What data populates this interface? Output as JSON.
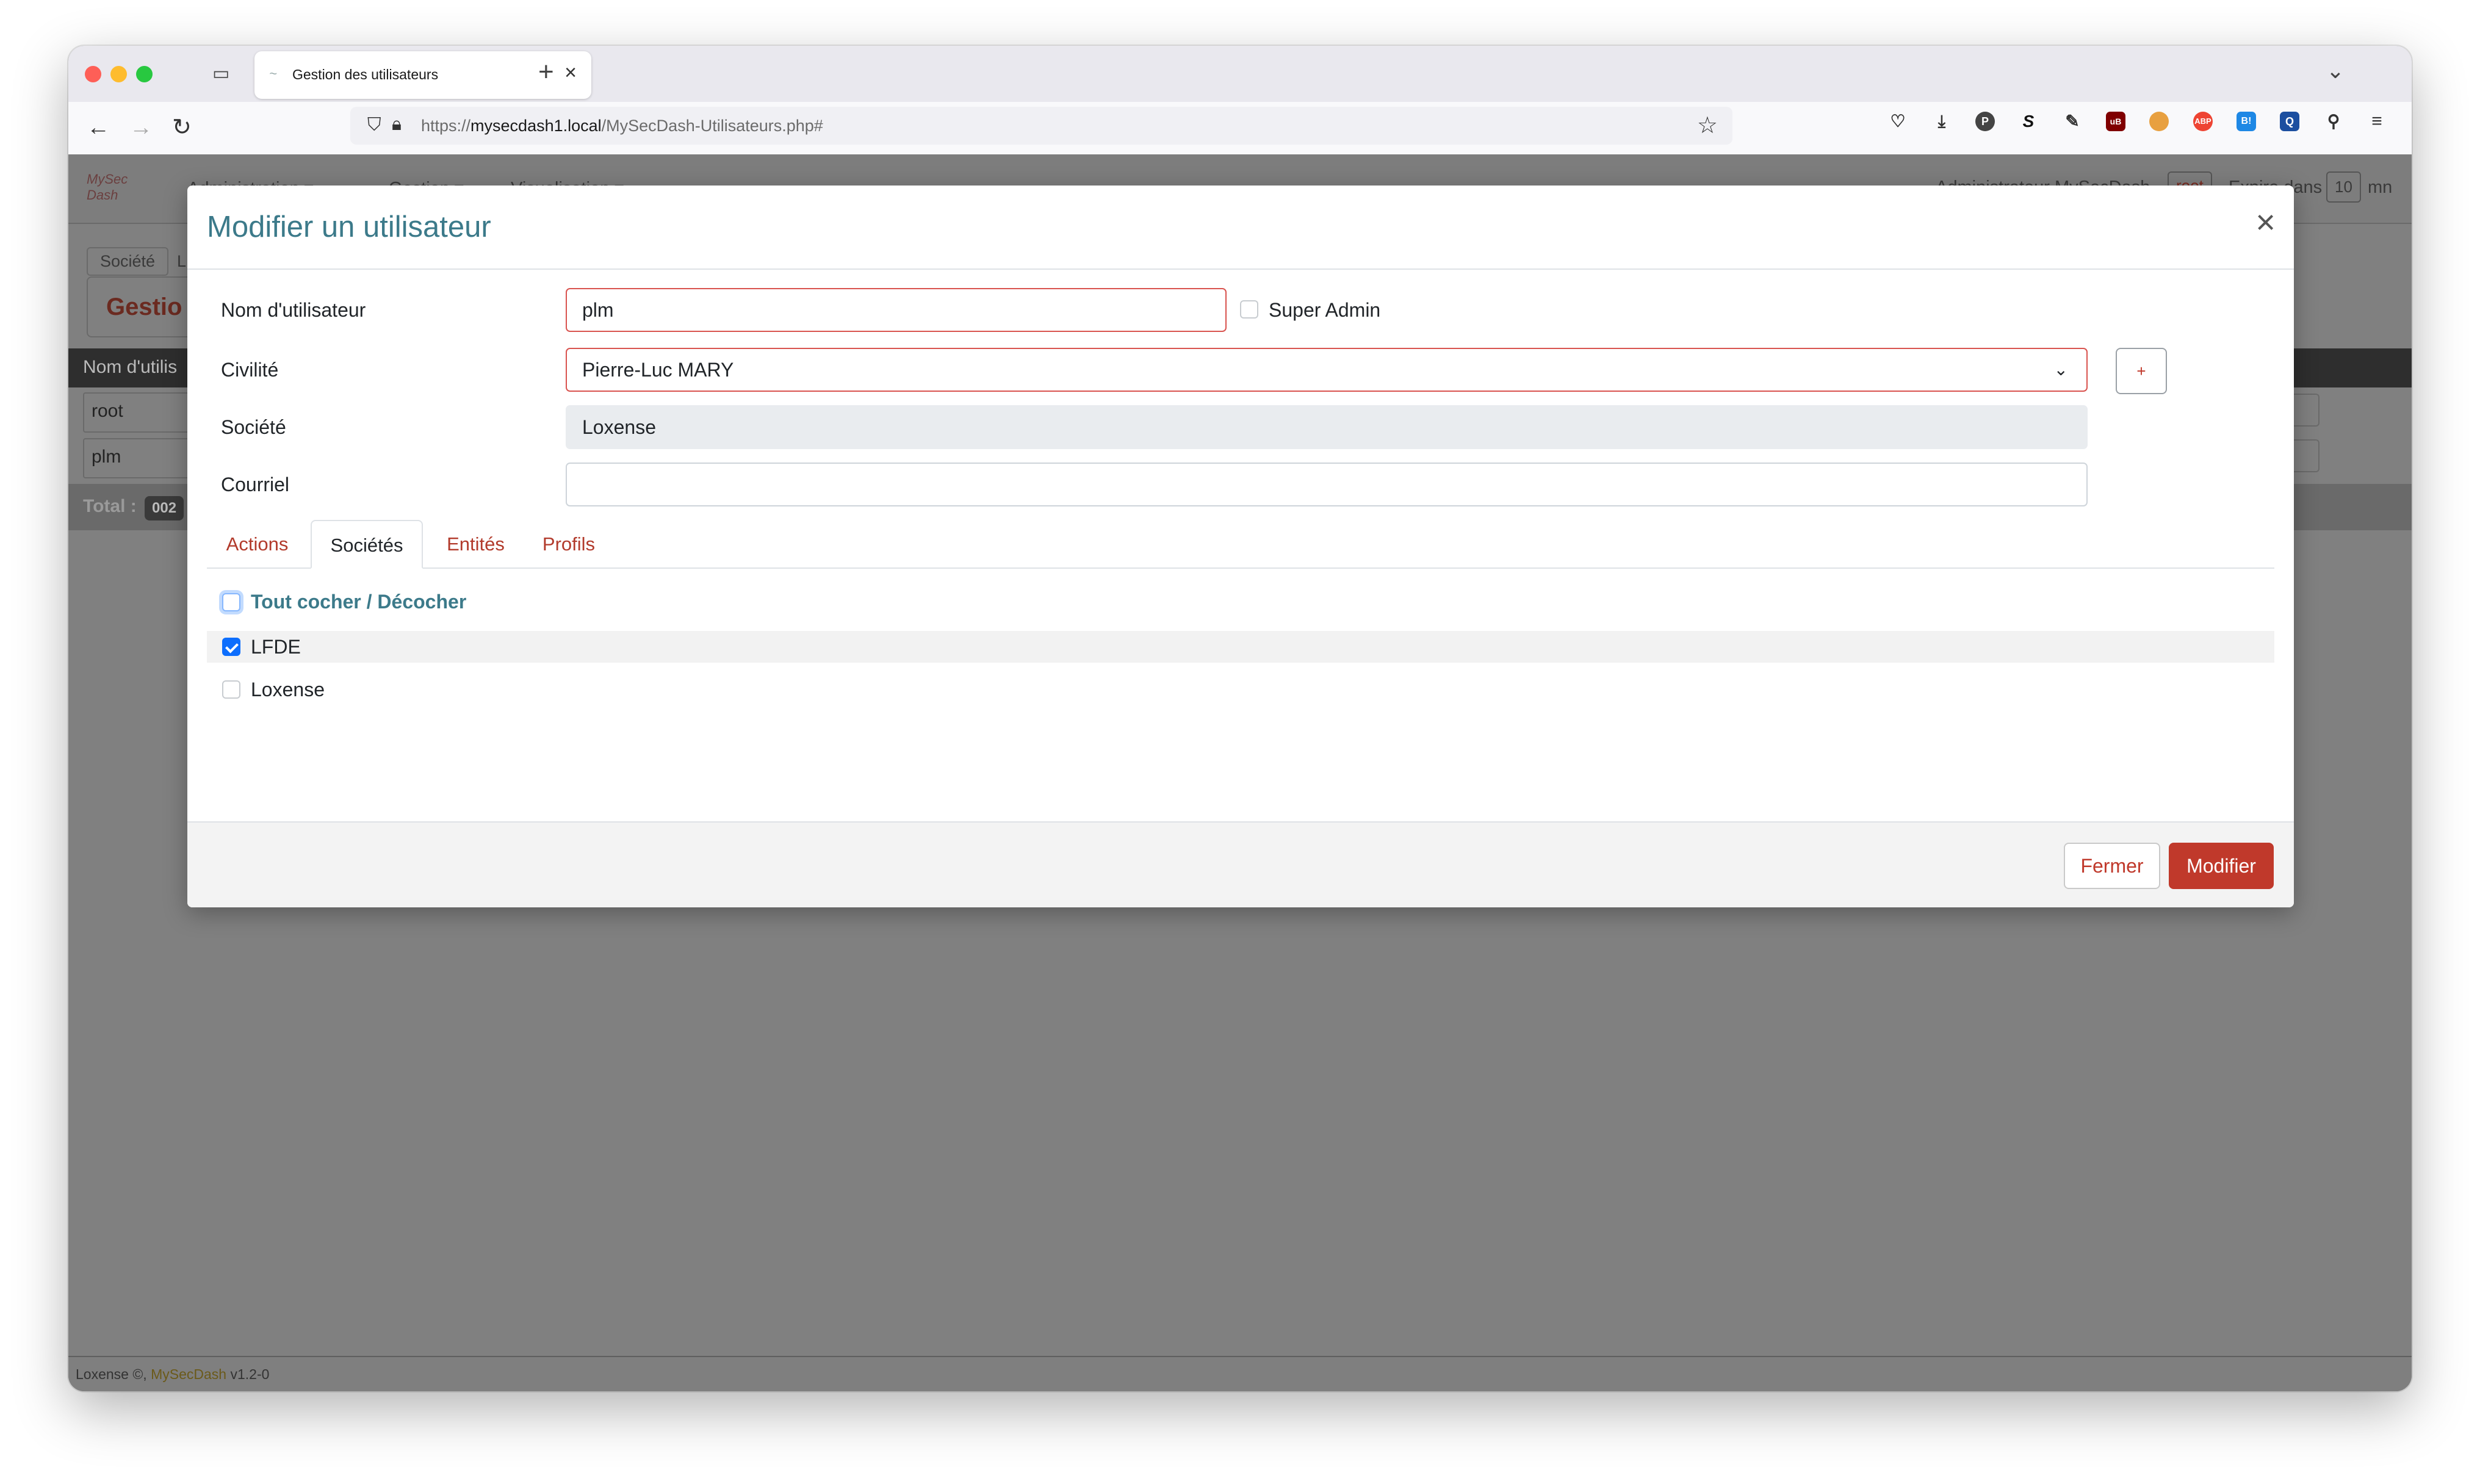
{
  "browser": {
    "tab_title": "Gestion des utilisateurs",
    "tab_close": "×",
    "new_tab": "+",
    "tabs_menu": "⌄",
    "url_domain": "mysecdash1.local",
    "url_prefix": "https://",
    "url_path": "/MySecDash-Utilisateurs.php#",
    "extensions": [
      "pocket-icon",
      "download-icon",
      "p-extension-icon",
      "s-extension-icon",
      "pen-icon",
      "ublock-icon",
      "monkey-icon",
      "abp-icon",
      "bi-icon",
      "q-extension-icon",
      "extensions-icon",
      "menu-icon"
    ]
  },
  "page": {
    "menu": [
      "Administration ▾",
      "Gestion ▾",
      "Visualisation ▾"
    ],
    "user_text": "Administrateur MySecDash",
    "user_login": "root",
    "expire_label": "Expire dans",
    "expire_value": "10",
    "expire_unit": "mn",
    "breadcrumb": "Société",
    "breadcrumb_next": "L",
    "section_title": "Gestio",
    "table_header": "Nom d'utilis",
    "rows": [
      "root",
      "plm"
    ],
    "total_label": "Total :",
    "total_value": "002",
    "footer_company": "Loxense",
    "footer_product": "MySecDash",
    "footer_version": "v1.2-0"
  },
  "modal": {
    "title": "Modifier un utilisateur",
    "close": "×",
    "username_label": "Nom d'utilisateur",
    "username_value": "plm",
    "super_admin_label": "Super Admin",
    "civility_label": "Civilité",
    "civility_value": "Pierre-Luc MARY",
    "add_button": "+",
    "company_label": "Société",
    "company_value": "Loxense",
    "email_label": "Courriel",
    "email_value": "",
    "tabs": [
      "Actions",
      "Sociétés",
      "Entités",
      "Profils"
    ],
    "toggle_all_label": "Tout cocher / Décocher",
    "companies": [
      {
        "label": "LFDE",
        "checked": true
      },
      {
        "label": "Loxense",
        "checked": false
      }
    ],
    "close_button": "Fermer",
    "submit_button": "Modifier"
  },
  "colors": {
    "accent_title": "#3c7a8a",
    "danger": "#c0392b",
    "checkbox_blue": "#0d6efd"
  }
}
